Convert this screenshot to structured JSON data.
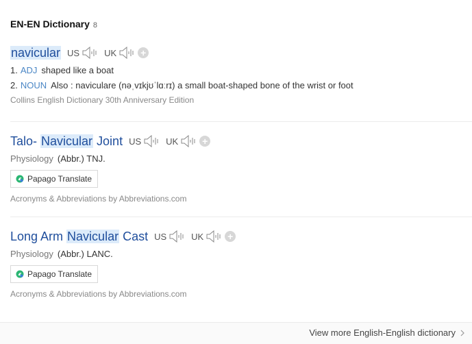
{
  "header": {
    "title": "EN-EN Dictionary",
    "count": "8"
  },
  "entries": [
    {
      "word_before": "",
      "word_highlight": "navicular",
      "word_after": "",
      "us_label": "US",
      "uk_label": "UK",
      "definitions": [
        {
          "num": "1.",
          "pos": "ADJ",
          "text": "shaped like a boat"
        },
        {
          "num": "2.",
          "pos": "NOUN",
          "text": "Also : naviculare (nəˌvɪkjʊˈlɑːrɪ) a small boat-shaped bone of the wrist or foot"
        }
      ],
      "source": "Collins English Dictionary 30th Anniversary Edition"
    },
    {
      "word_before": "Talo- ",
      "word_highlight": "Navicular",
      "word_after": " Joint",
      "us_label": "US",
      "uk_label": "UK",
      "field": "Physiology",
      "abbr": "(Abbr.) TNJ.",
      "translate_label": "Papago Translate",
      "source": "Acronyms & Abbreviations by Abbreviations.com"
    },
    {
      "word_before": "Long Arm ",
      "word_highlight": "Navicular",
      "word_after": " Cast",
      "us_label": "US",
      "uk_label": "UK",
      "field": "Physiology",
      "abbr": "(Abbr.) LANC.",
      "translate_label": "Papago Translate",
      "source": "Acronyms & Abbreviations by Abbreviations.com"
    }
  ],
  "footer": {
    "view_more": "View more English-English dictionary"
  },
  "colors": {
    "word": "#1f4e9c",
    "highlight": "#dcebfa",
    "pos": "#4a86c5",
    "papago_green": "#2bb673",
    "papago_blue": "#3b7ddd"
  },
  "icons": {
    "speaker": "speaker-icon",
    "plus": "plus-icon",
    "papago": "papago-logo-icon",
    "chevron": "chevron-right-icon"
  }
}
